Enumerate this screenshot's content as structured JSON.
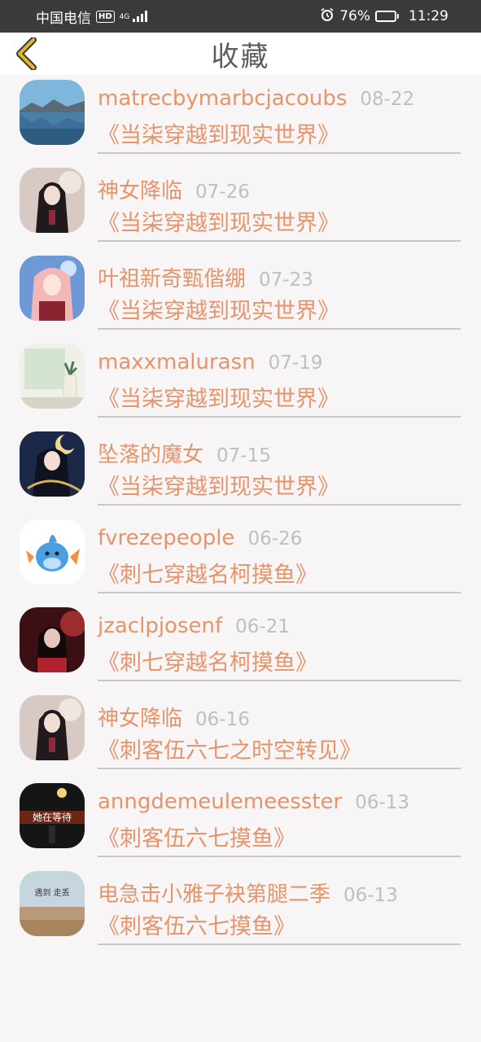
{
  "status_bar": {
    "carrier": "中国电信",
    "hd": "HD",
    "network": "4G",
    "battery": "76%",
    "battery_level": 0.76,
    "time": "11:29"
  },
  "header": {
    "title": "收藏"
  },
  "colors": {
    "accent": "#e6946a",
    "back_arrow": "#e6b825",
    "date": "#bfbfbf",
    "divider": "#c8c8c8"
  },
  "favorites": [
    {
      "user": "matrecbymarbcjacoubs",
      "date": "08-22",
      "book": "《当柒穿越到现实世界》",
      "avatar": "lake-landscape"
    },
    {
      "user": "神女降临",
      "date": "07-26",
      "book": "《当柒穿越到现实世界》",
      "avatar": "anime-girl-dark"
    },
    {
      "user": "叶祖新奇甄偕绷",
      "date": "07-23",
      "book": "《当柒穿越到现实世界》",
      "avatar": "anime-girl-pink"
    },
    {
      "user": "maxxmalurasn",
      "date": "07-19",
      "book": "《当柒穿越到现实世界》",
      "avatar": "window-plant"
    },
    {
      "user": "坠落的魔女",
      "date": "07-15",
      "book": "《当柒穿越到现实世界》",
      "avatar": "anime-witch"
    },
    {
      "user": "fvrezepeople",
      "date": "06-26",
      "book": "《刺七穿越名柯摸鱼》",
      "avatar": "blue-creature"
    },
    {
      "user": "jzaclpjosenf",
      "date": "06-21",
      "book": "《刺七穿越名柯摸鱼》",
      "avatar": "girl-red-light"
    },
    {
      "user": "神女降临",
      "date": "06-16",
      "book": "《刺客伍六七之时空转见》",
      "avatar": "anime-girl-dark"
    },
    {
      "user": "anngdemeulemeesster",
      "date": "06-13",
      "book": "《刺客伍六七摸鱼》",
      "avatar": "night-text",
      "avatar_text": "她在等待"
    },
    {
      "user": "电急击小雅子袂第腿二季",
      "date": "06-13",
      "book": "《刺客伍六七摸鱼》",
      "avatar": "beach-text",
      "avatar_text": "遇到 走丢"
    }
  ]
}
